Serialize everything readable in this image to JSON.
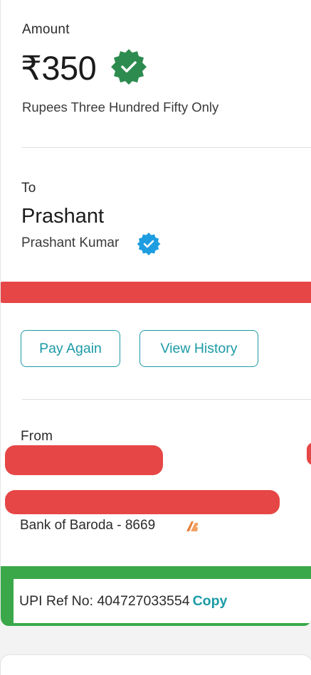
{
  "amount_section": {
    "label": "Amount",
    "value": "₹350",
    "in_words": "Rupees Three Hundred Fifty Only",
    "verified_icon": "verified-check-icon"
  },
  "to_section": {
    "label": "To",
    "name": "Prashant",
    "full_name": "Prashant Kumar",
    "verified_icon": "verified-check-icon"
  },
  "actions": {
    "pay_again": "Pay Again",
    "view_history": "View History"
  },
  "from_section": {
    "label": "From",
    "bank": "Bank of Baroda - 8669",
    "bank_icon": "bank-of-baroda-logo"
  },
  "upi": {
    "ref_label": "UPI Ref No: 404727033554",
    "copy_label": "Copy"
  },
  "colors": {
    "accent": "#1b9aa6",
    "verified_green": "#2e8b4f",
    "verified_blue": "#1e9de0",
    "redaction": "#e64646",
    "highlight_green": "#3aa848"
  }
}
